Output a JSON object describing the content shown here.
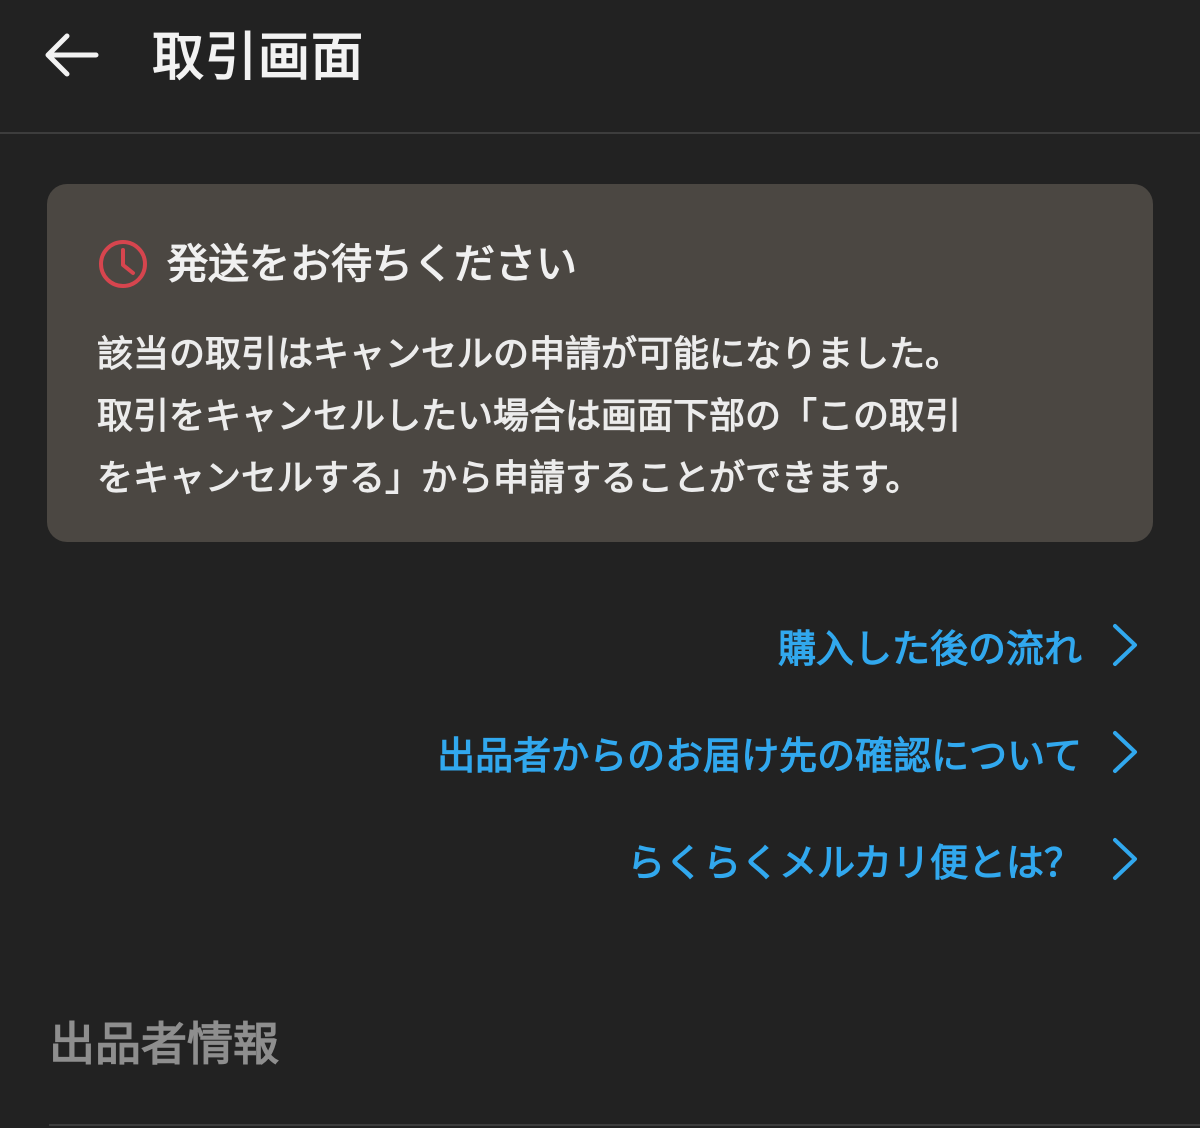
{
  "header": {
    "title": "取引画面",
    "back_icon": "arrow-left-icon"
  },
  "notice": {
    "icon": "clock-icon",
    "icon_color": "#d6454e",
    "title": "発送をお待ちください",
    "lines": [
      "該当の取引はキャンセルの申請が可能になりました。",
      "取引をキャンセルしたい場合は画面下部の「この取引",
      "をキャンセルする」から申請することができます。"
    ]
  },
  "links": [
    {
      "label": "購入した後の流れ",
      "icon": "chevron-right-icon"
    },
    {
      "label": "出品者からのお届け先の確認について",
      "icon": "chevron-right-icon"
    },
    {
      "label": "らくらくメルカリ便とは？",
      "icon": "chevron-right-icon"
    }
  ],
  "section": {
    "title": "出品者情報"
  },
  "colors": {
    "background": "#222222",
    "notice_bg": "#4b4742",
    "link": "#31a8ee",
    "section_title": "#8e8e8e"
  }
}
